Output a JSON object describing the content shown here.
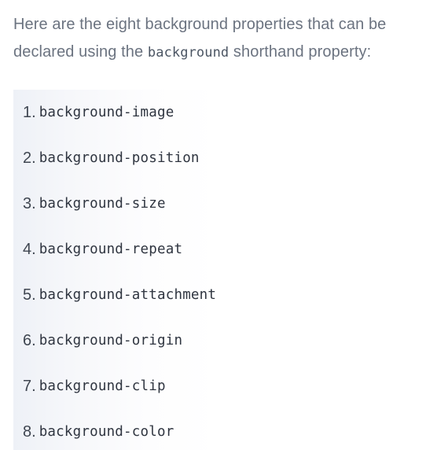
{
  "intro": {
    "text_before": "Here are the eight background properties that can be declared using the ",
    "code": "background",
    "text_after": " shorthand property:"
  },
  "list": {
    "items": [
      {
        "number": "1.",
        "property": "background-image"
      },
      {
        "number": "2.",
        "property": "background-position"
      },
      {
        "number": "3.",
        "property": "background-size"
      },
      {
        "number": "4.",
        "property": "background-repeat"
      },
      {
        "number": "5.",
        "property": "background-attachment"
      },
      {
        "number": "6.",
        "property": "background-origin"
      },
      {
        "number": "7.",
        "property": "background-clip"
      },
      {
        "number": "8.",
        "property": "background-color"
      }
    ]
  }
}
